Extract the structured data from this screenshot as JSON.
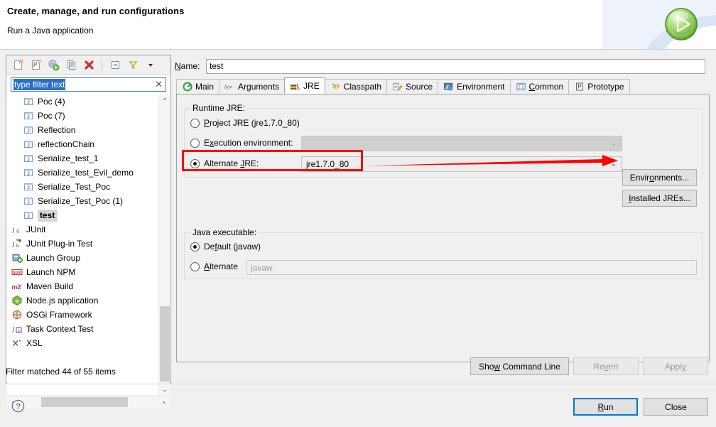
{
  "header": {
    "title": "Create, manage, and run configurations",
    "subtitle": "Run a Java application",
    "badge_icon": "run-play-icon"
  },
  "left_panel": {
    "toolbar": [
      {
        "name": "new-configuration-icon",
        "tooltip": "New launch configuration"
      },
      {
        "name": "new-prototype-icon",
        "tooltip": "New prototype"
      },
      {
        "name": "export-configuration-icon",
        "tooltip": "Export"
      },
      {
        "name": "duplicate-configuration-icon",
        "tooltip": "Duplicate"
      },
      {
        "name": "delete-configuration-icon",
        "tooltip": "Delete"
      },
      {
        "name": "collapse-all-icon",
        "tooltip": "Collapse All"
      },
      {
        "name": "filter-icon",
        "tooltip": "Filter"
      },
      {
        "name": "view-menu-icon",
        "tooltip": "View Menu"
      }
    ],
    "filter": {
      "value": "type filter text",
      "placeholder": "type filter text",
      "clear_icon": "clear-icon",
      "selected": true
    },
    "tree_items": [
      {
        "label": "Poc (4)",
        "icon": "java-launch-icon",
        "indent": true,
        "selected": false
      },
      {
        "label": "Poc (7)",
        "icon": "java-launch-icon",
        "indent": true,
        "selected": false
      },
      {
        "label": "Reflection",
        "icon": "java-launch-icon",
        "indent": true,
        "selected": false
      },
      {
        "label": "reflectionChain",
        "icon": "java-launch-icon",
        "indent": true,
        "selected": false
      },
      {
        "label": "Serialize_test_1",
        "icon": "java-launch-icon",
        "indent": true,
        "selected": false
      },
      {
        "label": "Serialize_test_Evil_demo",
        "icon": "java-launch-icon",
        "indent": true,
        "selected": false
      },
      {
        "label": "Serialize_Test_Poc",
        "icon": "java-launch-icon",
        "indent": true,
        "selected": false
      },
      {
        "label": "Serialize_Test_Poc (1)",
        "icon": "java-launch-icon",
        "indent": true,
        "selected": false
      },
      {
        "label": "test",
        "icon": "java-launch-icon",
        "indent": true,
        "selected": true
      },
      {
        "label": "JUnit",
        "icon": "junit-icon",
        "indent": false,
        "selected": false
      },
      {
        "label": "JUnit Plug-in Test",
        "icon": "junit-plugin-icon",
        "indent": false,
        "selected": false
      },
      {
        "label": "Launch Group",
        "icon": "launch-group-icon",
        "indent": false,
        "selected": false
      },
      {
        "label": "Launch NPM",
        "icon": "npm-icon",
        "indent": false,
        "selected": false
      },
      {
        "label": "Maven Build",
        "icon": "maven-icon",
        "indent": false,
        "selected": false
      },
      {
        "label": "Node.js application",
        "icon": "nodejs-icon",
        "indent": false,
        "selected": false
      },
      {
        "label": "OSGi Framework",
        "icon": "osgi-icon",
        "indent": false,
        "selected": false
      },
      {
        "label": "Task Context Test",
        "icon": "task-context-icon",
        "indent": false,
        "selected": false
      },
      {
        "label": "XSL",
        "icon": "xsl-icon",
        "indent": false,
        "selected": false
      }
    ],
    "status": "Filter matched 44 of 55 items",
    "scroll": {
      "vertical_icon_up": "chevron-up-icon",
      "vertical_icon_down": "chevron-down-icon",
      "horizontal_icon_left": "chevron-left-icon",
      "horizontal_icon_right": "chevron-right-icon"
    }
  },
  "right_panel": {
    "name_label": "Name:",
    "name_label_mnemonic": "N",
    "name_value": "test",
    "tabs": [
      {
        "label": "Main",
        "icon": "main-tab-icon",
        "active": false,
        "mnemonic": ""
      },
      {
        "label": "Arguments",
        "icon": "arguments-tab-icon",
        "active": false,
        "mnemonic": ""
      },
      {
        "label": "JRE",
        "icon": "jre-tab-icon",
        "active": true,
        "mnemonic": ""
      },
      {
        "label": "Classpath",
        "icon": "classpath-tab-icon",
        "active": false,
        "mnemonic": ""
      },
      {
        "label": "Source",
        "icon": "source-tab-icon",
        "active": false,
        "mnemonic": ""
      },
      {
        "label": "Environment",
        "icon": "environment-tab-icon",
        "active": false,
        "mnemonic": ""
      },
      {
        "label": "Common",
        "icon": "common-tab-icon",
        "active": false,
        "mnemonic": "C"
      },
      {
        "label": "Prototype",
        "icon": "prototype-tab-icon",
        "active": false,
        "mnemonic": ""
      }
    ],
    "runtime_jre": {
      "group_title": "Runtime JRE:",
      "options": [
        {
          "label": "Project JRE (jre1.7.0_80)",
          "selected": false,
          "mnemonic": "P"
        },
        {
          "label": "Execution environment:",
          "selected": false,
          "mnemonic": "x"
        },
        {
          "label": "Alternate JRE:",
          "selected": true,
          "mnemonic": "J"
        }
      ],
      "execution_env_value": "",
      "alternate_jre_value": "jre1.7.0_80",
      "environments_button": "Environments...",
      "environments_mnemonic": "o",
      "installed_jres_button": "Installed JREs...",
      "installed_jres_mnemonic": "I",
      "dropdown_icon": "chevron-down-icon"
    },
    "java_executable": {
      "group_title": "Java executable:",
      "options": [
        {
          "label": "Default (javaw)",
          "selected": true,
          "mnemonic": "f"
        },
        {
          "label": "Alternate",
          "selected": false,
          "mnemonic": "A"
        }
      ],
      "alternate_value": "",
      "alternate_placeholder": "javaw"
    },
    "action_buttons": [
      {
        "label": "Show Command Line",
        "enabled": true,
        "mnemonic": "w",
        "name": "show-command-line-button"
      },
      {
        "label": "Revert",
        "enabled": false,
        "mnemonic": "v",
        "name": "revert-button"
      },
      {
        "label": "Apply",
        "enabled": false,
        "mnemonic": "y",
        "name": "apply-button"
      }
    ]
  },
  "dialog_buttons": [
    {
      "label": "Run",
      "default": true,
      "mnemonic": "R",
      "name": "run-button"
    },
    {
      "label": "Close",
      "default": false,
      "mnemonic": "",
      "name": "close-button"
    }
  ],
  "help_icon": "help-question-icon",
  "annotations": {
    "highlight_box_color": "#ff0000",
    "arrow_color": "#ff0000",
    "arrow_direction": "right",
    "highlight_target": "alternate-jre-row"
  },
  "colors": {
    "accent_blue": "#0078d7",
    "selection_blue": "#2a6fc9",
    "panel_bg": "#f0f0f0",
    "field_bg": "#ffffff"
  }
}
